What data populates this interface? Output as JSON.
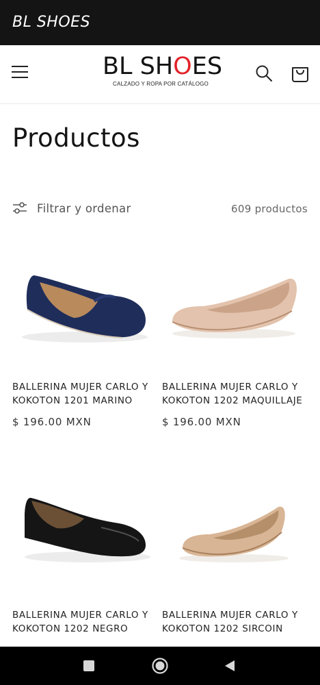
{
  "app": {
    "title": "BL SHOES"
  },
  "header": {
    "logo_main_pre": "BL SH",
    "logo_main_o": "O",
    "logo_main_post": "ES",
    "logo_sub": "CALZADO Y ROPA POR CATÁLOGO",
    "icons": [
      "menu-icon",
      "search-icon",
      "cart-icon"
    ]
  },
  "page": {
    "title": "Productos",
    "filter_label": "Filtrar y ordenar",
    "product_count": "609 productos"
  },
  "products": [
    {
      "name": "BALLERINA MUJER CARLO Y KOKOTON 1201 MARINO",
      "price": "$ 196.00 MXN",
      "color": "#1f2d5a"
    },
    {
      "name": "BALLERINA MUJER CARLO Y KOKOTON 1202 MAQUILLAJE",
      "price": "$ 196.00 MXN",
      "color": "#e3c3ad"
    },
    {
      "name": "BALLERINA MUJER CARLO Y KOKOTON 1202 NEGRO",
      "price": "",
      "color": "#151515"
    },
    {
      "name": "BALLERINA MUJER CARLO Y KOKOTON 1202 SIRCOIN",
      "price": "",
      "color": "#d8b594"
    }
  ],
  "colors": {
    "accent": "#e2232a",
    "topbar": "#141414",
    "navbar": "#000000"
  },
  "system_nav": [
    "recent-apps-icon",
    "home-icon",
    "back-icon"
  ]
}
